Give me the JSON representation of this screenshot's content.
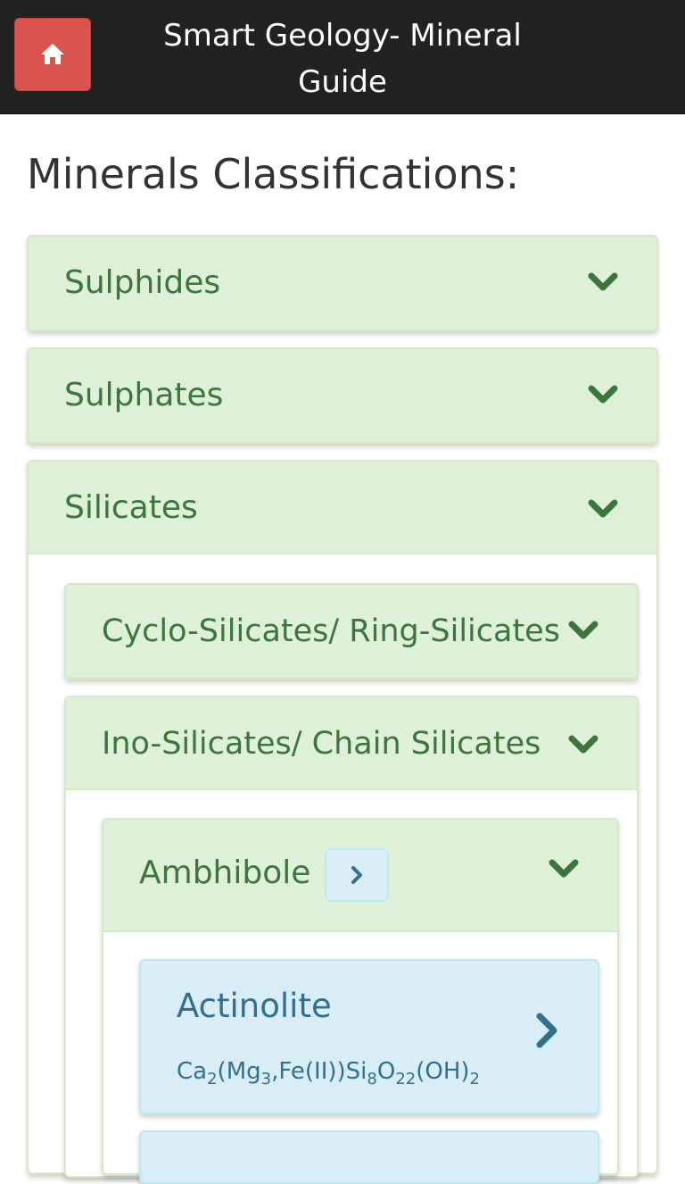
{
  "header": {
    "title": "Smart Geology- Mineral Guide",
    "home_icon": "home-icon",
    "home_button_color": "#d9534f"
  },
  "page": {
    "title": "Minerals Classifications:"
  },
  "classifications": [
    {
      "label": "Sulphides",
      "expanded": false
    },
    {
      "label": "Sulphates",
      "expanded": false
    },
    {
      "label": "Silicates",
      "expanded": true
    }
  ],
  "silicates_groups": [
    {
      "label": "Cyclo-Silicates/ Ring-Silicates",
      "expanded": false
    },
    {
      "label": "Ino-Silicates/ Chain Silicates",
      "expanded": true
    }
  ],
  "ino_groups": [
    {
      "label": "Ambhibole",
      "expanded": true
    }
  ],
  "minerals": [
    {
      "name": "Actinolite",
      "formula_parts": [
        "Ca",
        "2",
        "(Mg",
        "3",
        ",Fe(II))Si",
        "8",
        "O",
        "22",
        "(OH)",
        "2"
      ]
    }
  ],
  "colors": {
    "header_bg": "#222222",
    "success_bg": "#dff0d8",
    "success_text": "#3c763d",
    "info_bg": "#d9edf7",
    "info_text": "#31708f"
  }
}
